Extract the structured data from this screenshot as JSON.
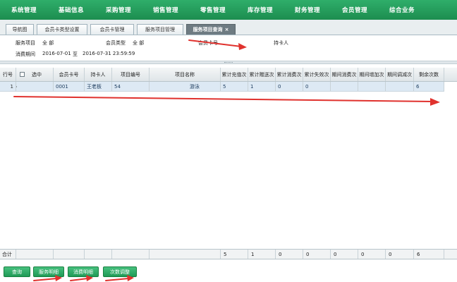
{
  "nav": {
    "items": [
      "系统管理",
      "基础信息",
      "采购管理",
      "销售管理",
      "零售管理",
      "库存管理",
      "财务管理",
      "会员管理",
      "综合业务"
    ]
  },
  "tabs": [
    {
      "label": "导航图"
    },
    {
      "label": "会员卡类型设置"
    },
    {
      "label": "会员卡管理"
    },
    {
      "label": "服务项目管理"
    },
    {
      "label": "服务项目查询",
      "close": "×"
    }
  ],
  "filters": {
    "service_item_label": "服务项目",
    "service_item_value": "全  部",
    "card_type_label": "会员类型",
    "card_type_value": "全  部",
    "card_no_label": "会员卡号",
    "holder_label": "持卡人",
    "period_label": "消费期间",
    "period_start": "2016-07-01",
    "period_to": "至",
    "period_end": "2016-07-31 23:59:59"
  },
  "grid": {
    "headers": [
      "行号",
      "选中",
      "会员卡号",
      "持卡人",
      "项目编号",
      "项目名称",
      "累计充值次",
      "累计赠送次",
      "累计消费次",
      "累计失效次",
      "期间消费次",
      "期间增加次",
      "期间调减次",
      "剩余次数"
    ],
    "row": {
      "rownum": "1",
      "card_no": "0001",
      "holder": "王老板",
      "item_code": "54",
      "item_name": "游泳",
      "total_recharge": "5",
      "total_gift": "1",
      "total_consume": "0",
      "total_expire": "0",
      "remaining": "6"
    },
    "footer": {
      "label": "合计",
      "values": [
        "5",
        "1",
        "0",
        "0",
        "0",
        "0",
        "0",
        "6"
      ]
    }
  },
  "buttons": {
    "query": "查询",
    "service_detail": "服务明细",
    "consume_detail": "消费明细",
    "count_adjust": "次数调整"
  },
  "colors": {
    "nav_green": "#1c8d4f",
    "button_green": "#2aa862",
    "annotation_red": "#e0322e"
  }
}
